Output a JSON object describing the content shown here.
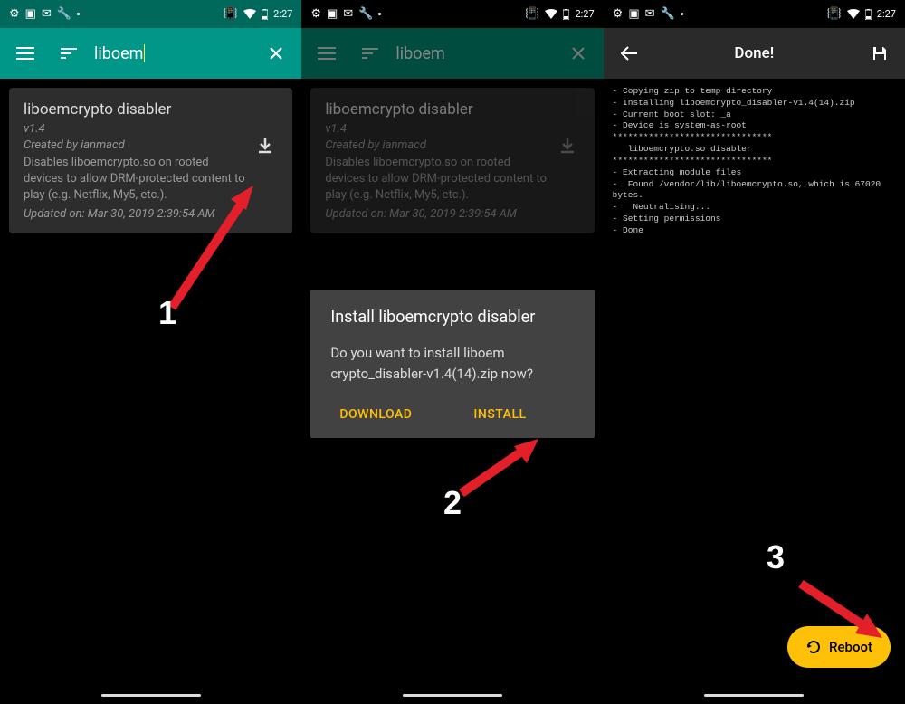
{
  "status": {
    "time": "2:27"
  },
  "search": {
    "query": "liboem"
  },
  "module": {
    "title": "liboemcrypto disabler",
    "version": "v1.4",
    "author": "Created by ianmacd",
    "description": "Disables liboemcrypto.so on rooted devices to allow DRM-protected content to play (e.g. Netflix, My5, etc.).",
    "updated": "Updated on: Mar 30, 2019 2:39:54 AM"
  },
  "dialog": {
    "title": "Install liboemcrypto disabler",
    "body": "Do you want to install liboem crypto_disabler-v1.4(14).zip now?",
    "download": "DOWNLOAD",
    "install": "INSTALL"
  },
  "done": {
    "title": "Done!",
    "log": "- Copying zip to temp directory\n- Installing liboemcrypto_disabler-v1.4(14).zip\n- Current boot slot: _a\n- Device is system-as-root\n*******************************\n   liboemcrypto.so disabler\n*******************************\n- Extracting module files\n-  Found /vendor/lib/liboemcrypto.so, which is 67020 bytes.\n-   Neutralising...\n- Setting permissions\n- Done",
    "reboot": "Reboot"
  },
  "steps": {
    "one": "1",
    "two": "2",
    "three": "3"
  }
}
